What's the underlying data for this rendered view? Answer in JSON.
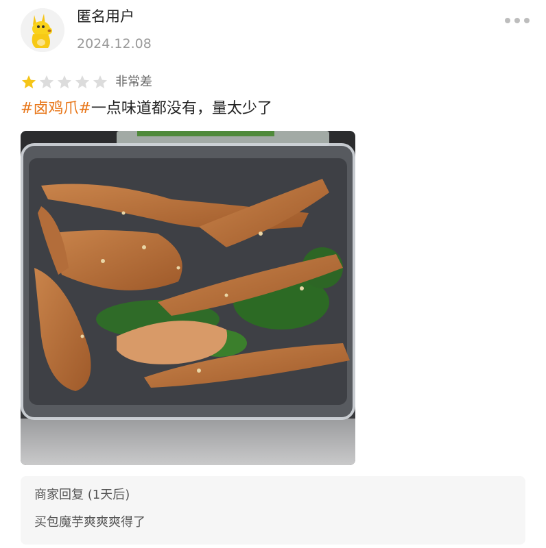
{
  "review": {
    "username": "匿名用户",
    "date": "2024.12.08",
    "avatar_icon": "kangaroo-mascot-icon",
    "more_icon": "more-dots-icon",
    "rating": {
      "filled": 1,
      "max": 5,
      "label": "非常差",
      "filled_color": "#f5c518",
      "empty_color": "#dcdcdc"
    },
    "tag": "#卤鸡爪#",
    "text": "一点味道都没有，量太少了",
    "tag_color": "#e8771a"
  },
  "photo": {
    "alt_icon": "food-photo-chicken-feet"
  },
  "merchant_reply": {
    "title": "商家回复 (1天后)",
    "text": "买包魔芋爽爽爽得了"
  }
}
